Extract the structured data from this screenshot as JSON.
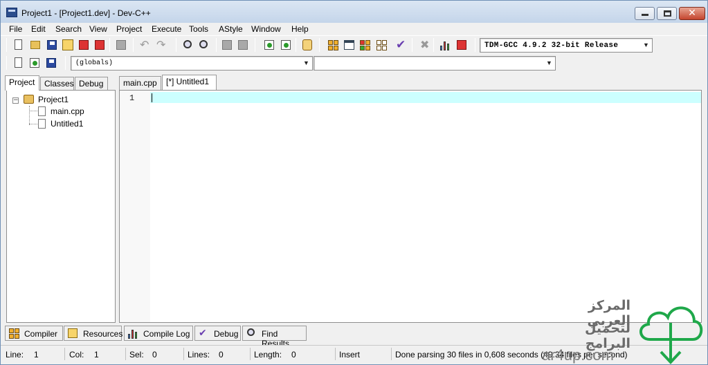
{
  "window": {
    "title": "Project1 - [Project1.dev] - Dev-C++"
  },
  "menu": [
    "File",
    "Edit",
    "Search",
    "View",
    "Project",
    "Execute",
    "Tools",
    "AStyle",
    "Window",
    "Help"
  ],
  "toolbar": {
    "compiler_select": "TDM-GCC 4.9.2 32-bit Release",
    "scope_select": "(globals)",
    "function_select": ""
  },
  "left_panel": {
    "tabs": [
      "Project",
      "Classes",
      "Debug"
    ],
    "tree": {
      "root": "Project1",
      "children": [
        "main.cpp",
        "Untitled1"
      ]
    }
  },
  "editor": {
    "tabs": [
      "main.cpp",
      "[*] Untitled1"
    ],
    "line_number": "1"
  },
  "bottom_tabs": [
    "Compiler",
    "Resources",
    "Compile Log",
    "Debug",
    "Find Results"
  ],
  "status": {
    "line_label": "Line:",
    "line_value": "1",
    "col_label": "Col:",
    "col_value": "1",
    "sel_label": "Sel:",
    "sel_value": "0",
    "lines_label": "Lines:",
    "lines_value": "0",
    "length_label": "Length:",
    "length_value": "0",
    "mode": "Insert",
    "message": "Done parsing 30 files in 0,608 seconds (49.34 files per second)"
  },
  "watermark": {
    "line1": "المركز العربي",
    "line2": "لتحميل البرامج",
    "url": "ar4up.com"
  },
  "colors": {
    "active_line": "#ccffff",
    "watermark_green": "#1fa84a"
  }
}
